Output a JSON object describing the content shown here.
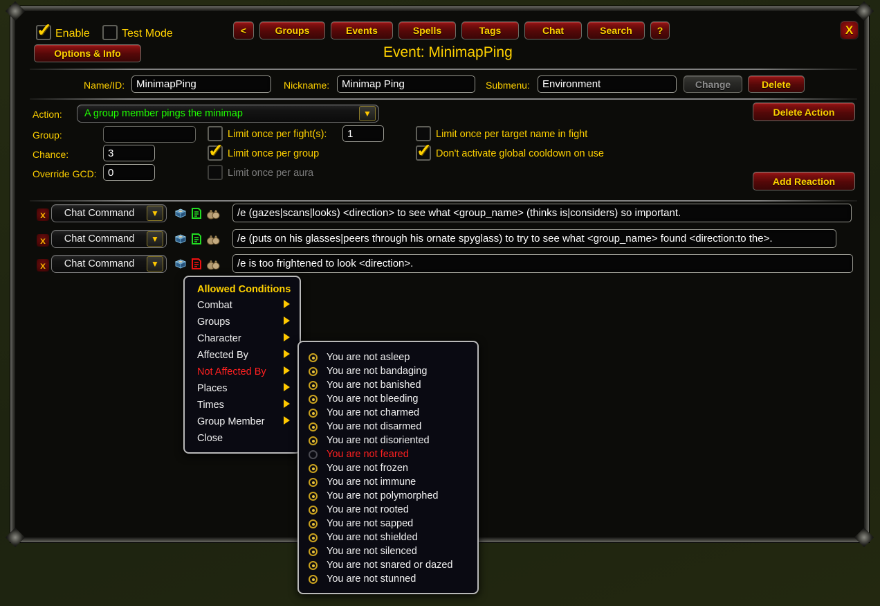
{
  "header": {
    "enable_label": "Enable",
    "enable_checked": true,
    "test_mode_label": "Test Mode",
    "test_mode_checked": false,
    "options_info_label": "Options & Info",
    "nav_buttons": [
      "<",
      "Groups",
      "Events",
      "Spells",
      "Tags",
      "Chat",
      "Search",
      "?"
    ],
    "close_label": "X",
    "event_title": "Event: MinimapPing"
  },
  "identity": {
    "name_label": "Name/ID:",
    "name_value": "MinimapPing",
    "nickname_label": "Nickname:",
    "nickname_value": "Minimap Ping",
    "submenu_label": "Submenu:",
    "submenu_value": "Environment",
    "change_label": "Change",
    "delete_label": "Delete"
  },
  "action": {
    "label": "Action:",
    "value": "A group member pings the minimap",
    "delete_action_label": "Delete Action"
  },
  "options": {
    "group_label": "Group:",
    "group_value": "",
    "chance_label": "Chance:",
    "chance_value": "3",
    "override_gcd_label": "Override GCD:",
    "override_gcd_value": "0",
    "limit_fight_label": "Limit once per fight(s):",
    "limit_fight_checked": false,
    "limit_fight_value": "1",
    "limit_group_label": "Limit once per group",
    "limit_group_checked": true,
    "limit_aura_label": "Limit once per aura",
    "limit_aura_checked": false,
    "limit_aura_disabled": true,
    "limit_target_label": "Limit once per target name in fight",
    "limit_target_checked": false,
    "no_gcd_label": "Don't activate global cooldown on use",
    "no_gcd_checked": true,
    "add_reaction_label": "Add Reaction"
  },
  "reactions": [
    {
      "delete": "x",
      "type": "Chat Command",
      "book_icon": "book-icon",
      "doc_icon": "document-icon",
      "doc_color": "#22dd22",
      "bag_icon": "money-bag-icon",
      "text": "/e (gazes|scans|looks) <direction> to see what <group_name> (thinks is|considers) so important."
    },
    {
      "delete": "x",
      "type": "Chat Command",
      "book_icon": "book-icon",
      "doc_icon": "document-icon",
      "doc_color": "#22dd22",
      "bag_icon": "money-bag-icon",
      "text": "/e (puts on his glasses|peers through his ornate spyglass) to try to see what <group_name> found <direction:to the>."
    },
    {
      "delete": "x",
      "type": "Chat Command",
      "book_icon": "book-icon",
      "doc_icon": "document-icon",
      "doc_color": "#ee1111",
      "bag_icon": "money-bag-icon",
      "text": "/e is too frightened to look <direction>."
    }
  ],
  "conditions_menu": {
    "title": "Allowed Conditions",
    "items": [
      {
        "label": "Combat",
        "submenu": true,
        "highlighted": false
      },
      {
        "label": "Groups",
        "submenu": true,
        "highlighted": false
      },
      {
        "label": "Character",
        "submenu": true,
        "highlighted": false
      },
      {
        "label": "Affected By",
        "submenu": true,
        "highlighted": false
      },
      {
        "label": "Not Affected By",
        "submenu": true,
        "highlighted": true
      },
      {
        "label": "Places",
        "submenu": true,
        "highlighted": false
      },
      {
        "label": "Times",
        "submenu": true,
        "highlighted": false
      },
      {
        "label": "Group Member",
        "submenu": true,
        "highlighted": false
      },
      {
        "label": "Close",
        "submenu": false,
        "highlighted": false
      }
    ]
  },
  "not_affected_submenu": {
    "items": [
      {
        "label": "You are not asleep",
        "selected": true,
        "highlighted": false
      },
      {
        "label": "You are not bandaging",
        "selected": true,
        "highlighted": false
      },
      {
        "label": "You are not banished",
        "selected": true,
        "highlighted": false
      },
      {
        "label": "You are not bleeding",
        "selected": true,
        "highlighted": false
      },
      {
        "label": "You are not charmed",
        "selected": true,
        "highlighted": false
      },
      {
        "label": "You are not disarmed",
        "selected": true,
        "highlighted": false
      },
      {
        "label": "You are not disoriented",
        "selected": true,
        "highlighted": false
      },
      {
        "label": "You are not feared",
        "selected": false,
        "highlighted": true
      },
      {
        "label": "You are not frozen",
        "selected": true,
        "highlighted": false
      },
      {
        "label": "You are not immune",
        "selected": true,
        "highlighted": false
      },
      {
        "label": "You are not polymorphed",
        "selected": true,
        "highlighted": false
      },
      {
        "label": "You are not rooted",
        "selected": true,
        "highlighted": false
      },
      {
        "label": "You are not sapped",
        "selected": true,
        "highlighted": false
      },
      {
        "label": "You are not shielded",
        "selected": true,
        "highlighted": false
      },
      {
        "label": "You are not silenced",
        "selected": true,
        "highlighted": false
      },
      {
        "label": "You are not snared or dazed",
        "selected": true,
        "highlighted": false
      },
      {
        "label": "You are not stunned",
        "selected": true,
        "highlighted": false
      }
    ]
  },
  "colors": {
    "gold": "#ffd100",
    "red_button": "#7b0f0f",
    "green_text": "#1eff00",
    "highlight_red": "#ff2020",
    "panel_bg": "#0c0c09",
    "desktop_bg": "#20250f"
  }
}
